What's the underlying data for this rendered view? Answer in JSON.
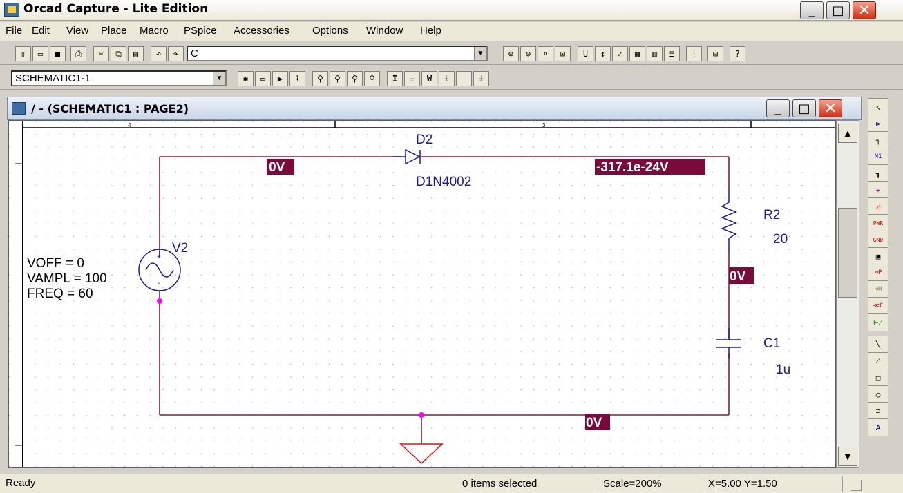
{
  "titlebar": {
    "title": "Orcad Capture - Lite Edition",
    "minimize": "_",
    "maximize": "□",
    "close": "✕"
  },
  "menu": [
    "File",
    "Edit",
    "View",
    "Place",
    "Macro",
    "PSpice",
    "Accessories",
    "Options",
    "Window",
    "Help"
  ],
  "toolbar1": {
    "part_combo_value": "C",
    "buttons": [
      "new-icon",
      "open-icon",
      "save-icon",
      "print-icon",
      "cut-icon",
      "copy-icon",
      "paste-icon",
      "undo-icon",
      "redo-icon",
      "zoom-in-icon",
      "zoom-out-icon",
      "zoom-area-icon",
      "zoom-all-icon",
      "annotate-icon",
      "back-annotate-icon",
      "drc-icon",
      "netlist-icon",
      "cross-ref-icon",
      "bom-icon",
      "snap-grid-icon",
      "project-manager-icon",
      "help-icon"
    ]
  },
  "toolbar2": {
    "profile_combo_value": "SCHEMATIC1-1",
    "buttons": [
      "new-profile-icon",
      "edit-profile-icon",
      "run-icon",
      "view-results-icon",
      "voltage-marker-icon",
      "voltage-diff-icon",
      "current-marker-icon",
      "power-marker-icon",
      "V",
      "V-enable",
      "I",
      "I-enable",
      "W",
      "W-enable"
    ]
  },
  "child_window": {
    "title": "/ - (SCHEMATIC1 : PAGE2)"
  },
  "schematic": {
    "ruler_marks": [
      "4",
      "3"
    ],
    "source": {
      "ref": "V2",
      "params": [
        "VOFF = 0",
        "VAMPL = 100",
        "FREQ = 60"
      ]
    },
    "diode": {
      "ref": "D2",
      "value": "D1N4002"
    },
    "resistor": {
      "ref": "R2",
      "value": "20"
    },
    "capacitor": {
      "ref": "C1",
      "value": "1u"
    },
    "bias_labels": {
      "left_top": "0V",
      "right_top": "-317.1e-24V",
      "mid_right": "0V",
      "bottom": "0V"
    },
    "colors": {
      "wire": "#8b1a3a",
      "part": "#1a1aa8",
      "bias_bg": "#7a0a3a",
      "junction": "#ff00ff",
      "ground": "#ff0000"
    }
  },
  "palette": [
    "select-icon",
    "place-part-icon",
    "place-wire-icon",
    "place-net-alias-icon",
    "place-bus-icon",
    "place-junction-icon",
    "place-bus-entry-icon",
    "place-power-icon",
    "place-ground-icon",
    "place-hierarchical-block-icon",
    "place-port-icon",
    "place-pin-icon",
    "place-off-page-icon",
    "place-no-connect-icon",
    "place-line-icon",
    "place-polyline-icon",
    "place-rectangle-icon",
    "place-ellipse-icon",
    "place-arc-icon",
    "place-text-icon"
  ],
  "statusbar": {
    "status": "Ready",
    "selection": "0 items selected",
    "scale": "Scale=200%",
    "coords": "X=5.00  Y=1.50"
  }
}
